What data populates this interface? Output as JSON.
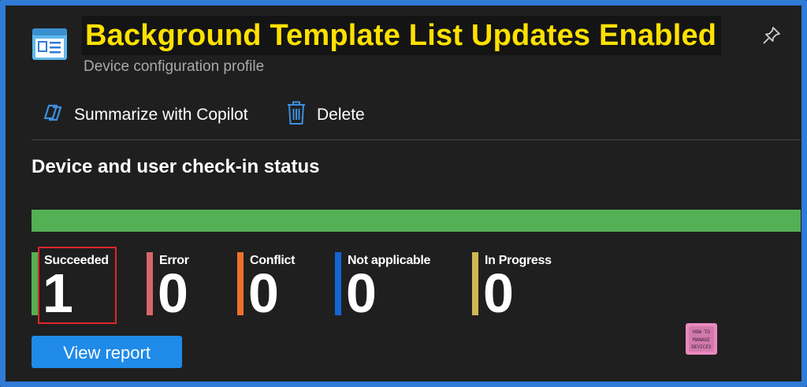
{
  "header": {
    "title": "Background Template List Updates Enabled",
    "subtitle": "Device configuration profile",
    "icon": "profile-window-icon",
    "pin_icon": "pin-icon"
  },
  "toolbar": {
    "summarize_label": "Summarize with Copilot",
    "summarize_icon": "copilot-icon",
    "delete_label": "Delete",
    "delete_icon": "trash-icon"
  },
  "status": {
    "section_title": "Device and user check-in status",
    "progress_fraction": 1.0,
    "colors": {
      "succeeded": "#54b054",
      "error": "#d7666d",
      "conflict": "#f0712b",
      "not_applicable": "#1466d4",
      "in_progress": "#d0b652"
    },
    "items": [
      {
        "label": "Succeeded",
        "value": "1"
      },
      {
        "label": "Error",
        "value": "0"
      },
      {
        "label": "Conflict",
        "value": "0"
      },
      {
        "label": "Not applicable",
        "value": "0"
      },
      {
        "label": "In Progress",
        "value": "0"
      }
    ]
  },
  "actions": {
    "view_report_label": "View report"
  },
  "watermark": {
    "text": "HOW TO MANAGE DEVICES"
  },
  "colors": {
    "title_text": "#ffe100",
    "frame": "#2f7bd6",
    "background": "#1f1f1f",
    "button": "#1f8ae8",
    "highlight": "#e0252a"
  }
}
